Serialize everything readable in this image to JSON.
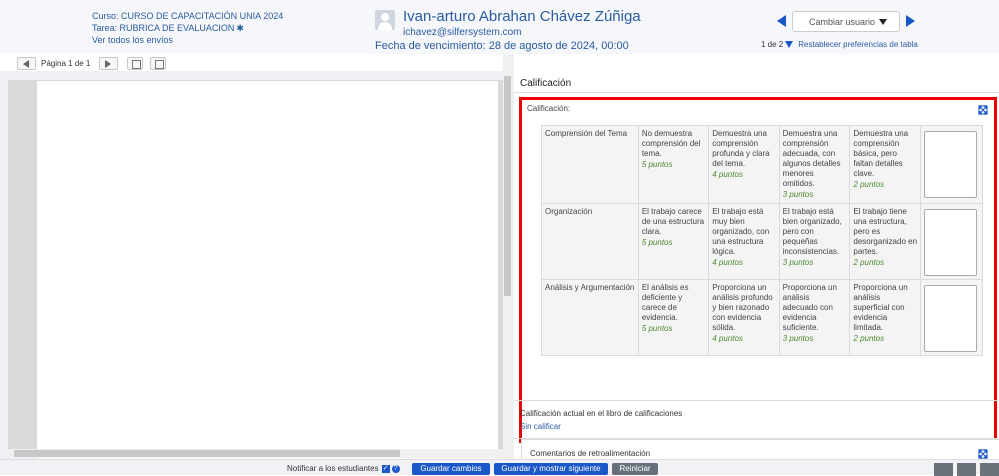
{
  "header": {
    "course": "Curso: CURSO DE CAPACITACIÓN UNIA 2024",
    "task": "Tarea: RUBRICA DE EVALUACION",
    "view_all": "Ver todos los envíos",
    "user_name": "Ivan-arturo Abrahan Chávez Zúñiga",
    "user_email": "ichavez@silfersystem.com",
    "due_date": "Fecha de vencimiento: 28 de agosto de 2024, 00:00",
    "change_user_placeholder": "Cambiar usuario",
    "pager": "1 de 2",
    "reset_prefs": "Restablecer preferencias de tabla"
  },
  "viewer": {
    "page_label": "Página 1 de 1"
  },
  "grading": {
    "section_title": "Calificación",
    "card_title": "Calificación:",
    "rubric": [
      {
        "criterion": "Comprensión del Tema",
        "levels": [
          {
            "desc": "No demuestra comprensión del tema.",
            "points": "5 puntos"
          },
          {
            "desc": "Demuestra una comprensión profunda y clara del tema.",
            "points": "4 puntos"
          },
          {
            "desc": "Demuestra una comprensión adecuada, con algunos detalles menores omitidos.",
            "points": "3 puntos"
          },
          {
            "desc": "Demuestra una comprensión básica, pero faltan detalles clave.",
            "points": "2 puntos"
          }
        ]
      },
      {
        "criterion": "Organización",
        "levels": [
          {
            "desc": "El trabajo carece de una estructura clara.",
            "points": "5 puntos"
          },
          {
            "desc": "El trabajo está muy bien organizado, con una estructura lógica.",
            "points": "4 puntos"
          },
          {
            "desc": "El trabajo está bien organizado, pero con pequeñas inconsistencias.",
            "points": "3 puntos"
          },
          {
            "desc": "El trabajo tiene una estructura, pero es desorganizado en partes.",
            "points": "2 puntos"
          }
        ]
      },
      {
        "criterion": "Análisis y Argumentación",
        "levels": [
          {
            "desc": "El análisis es deficiente y carece de evidencia.",
            "points": "5 puntos"
          },
          {
            "desc": "Proporciona un análisis profundo y bien razonado con evidencia sólida.",
            "points": "4 puntos"
          },
          {
            "desc": "Proporciona un análisis adecuado con evidencia suficiente.",
            "points": "3 puntos"
          },
          {
            "desc": "Proporciona un análisis superficial con evidencia limitada.",
            "points": "2 puntos"
          }
        ]
      }
    ],
    "current_grade_label": "Calificación actual en el libro de calificaciones",
    "current_grade_value": "Sin calificar",
    "feedback_title": "Comentarios de retroalimentación"
  },
  "footer": {
    "notify_label": "Notificar a los estudiantes",
    "save": "Guardar cambios",
    "save_next": "Guardar y mostrar siguiente",
    "reset": "Reiniciar"
  },
  "colors": {
    "accent": "#1a57c8",
    "highlight": "#e00000",
    "points": "#4a8a2e"
  }
}
